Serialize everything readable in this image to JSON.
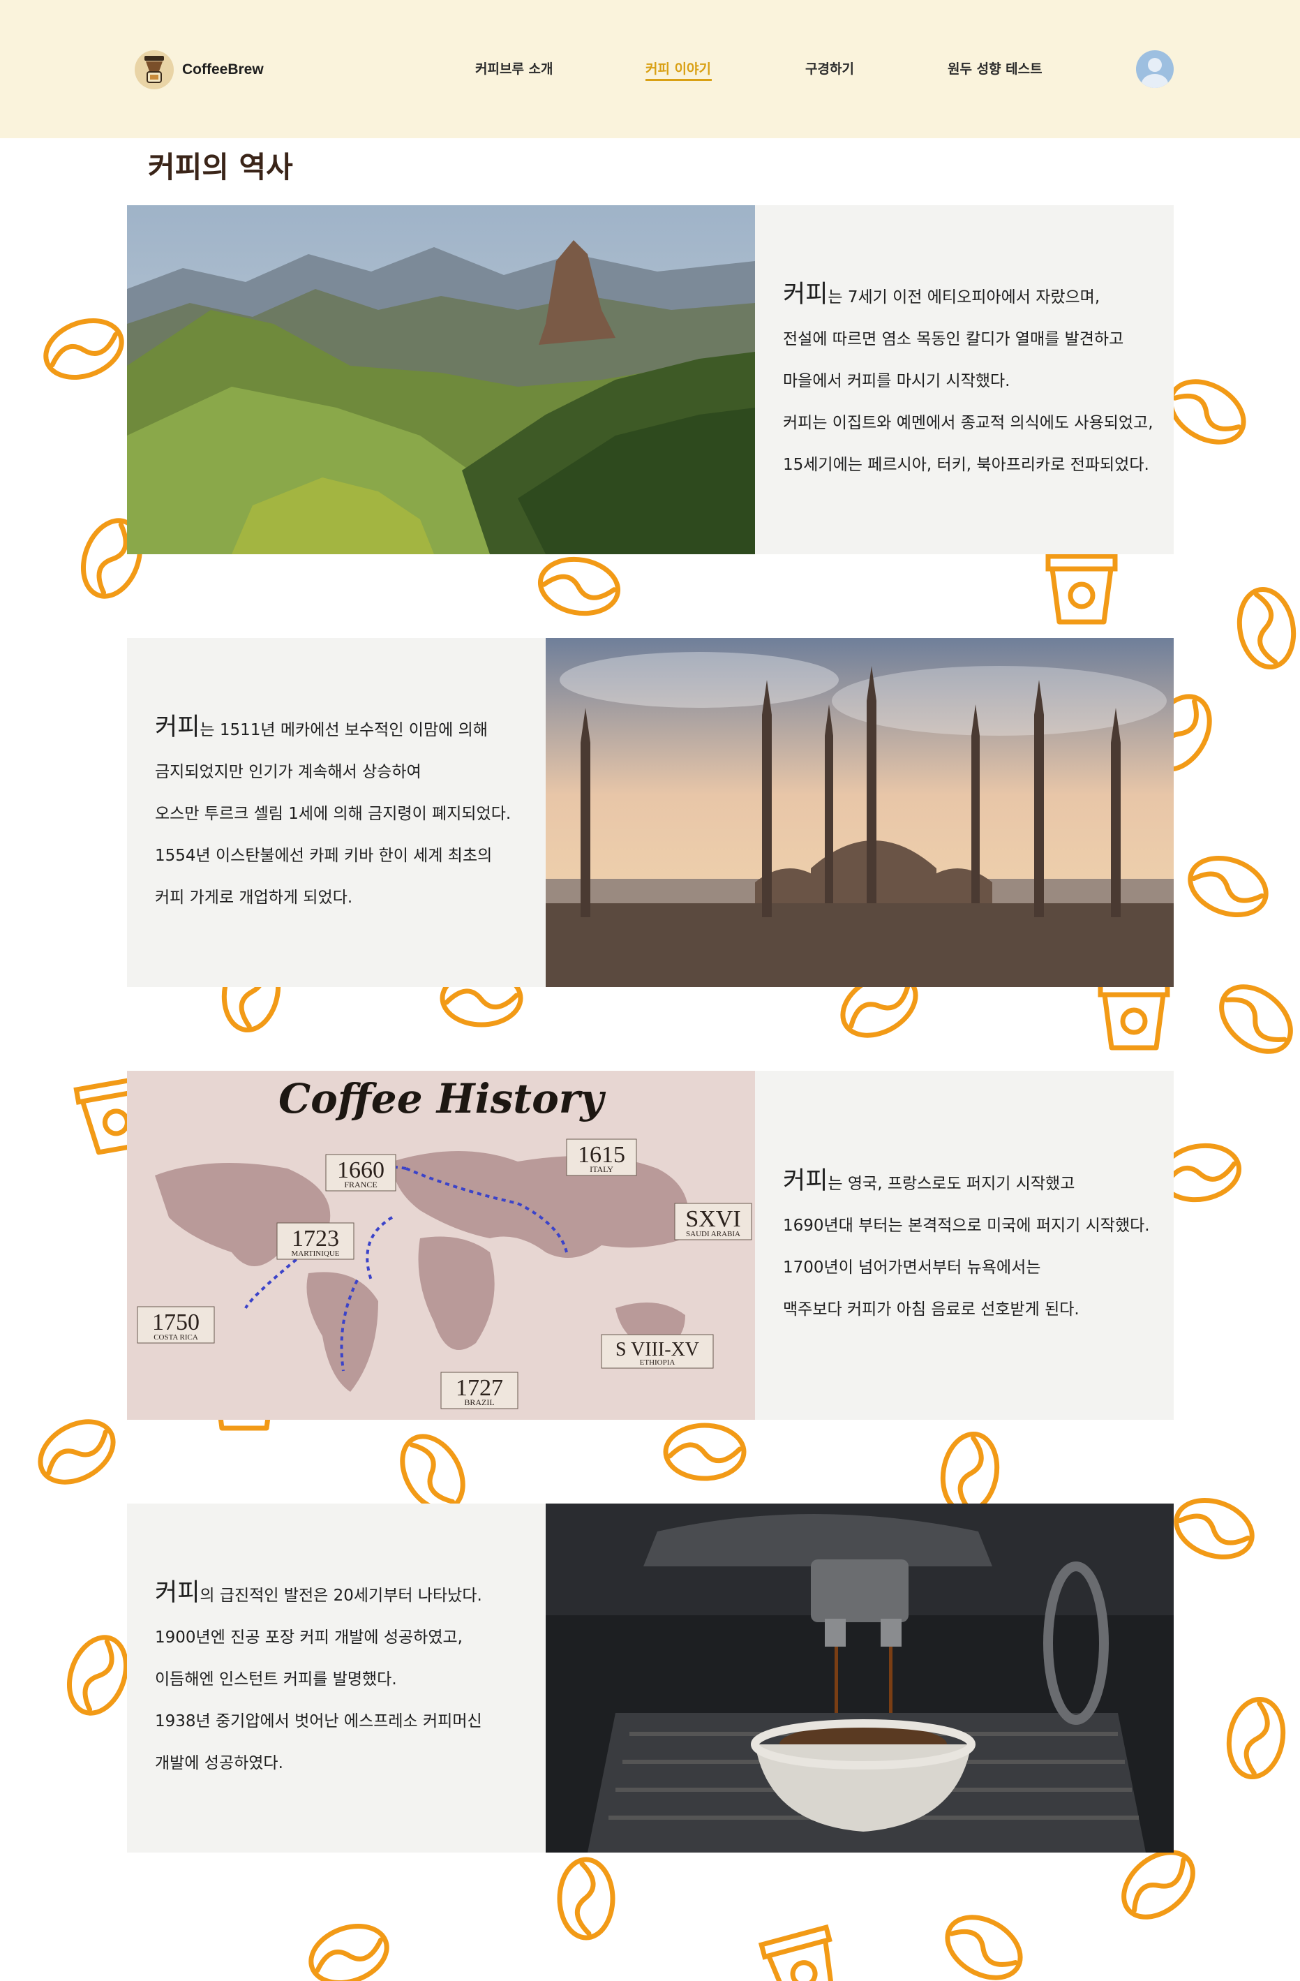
{
  "brand": {
    "name": "CoffeeBrew"
  },
  "nav": {
    "items": [
      {
        "label": "커피브루 소개"
      },
      {
        "label": "커피 이야기"
      },
      {
        "label": "구경하기"
      },
      {
        "label": "원두 성향 테스트"
      }
    ]
  },
  "page": {
    "title": "커피의 역사"
  },
  "colors": {
    "header_bg": "#faf3dc",
    "accent": "#d9a014",
    "doodle": "#f29a16",
    "card_bg": "#f3f3f1"
  },
  "sections": [
    {
      "image": "ethiopian-highlands-photo",
      "lead": "커피",
      "lines": [
        "는 7세기 이전 에티오피아에서 자랐으며,",
        "전설에 따르면 염소 목동인 칼디가 열매를 발견하고",
        "마을에서 커피를 마시기 시작했다.",
        "커피는 이집트와 예멘에서 종교적 의식에도 사용되었고,",
        "15세기에는 페르시아, 터키, 북아프리카로 전파되었다."
      ]
    },
    {
      "image": "istanbul-mosque-photo",
      "lead": "커피",
      "lines": [
        "는 1511년 메카에선 보수적인 이맘에 의해",
        "금지되었지만 인기가 계속해서 상승하여",
        "오스만 투르크 셀림 1세에 의해 금지령이 폐지되었다.",
        "1554년 이스탄불에선 카페 키바 한이 세계 최초의",
        "커피 가게로 개업하게 되었다."
      ]
    },
    {
      "image": "coffee-history-map",
      "map_title": "Coffee History",
      "map_labels": [
        {
          "year": "1660",
          "place": "FRANCE"
        },
        {
          "year": "1615",
          "place": "ITALY"
        },
        {
          "year": "SXVI",
          "place": "SAUDI ARABIA"
        },
        {
          "year": "1723",
          "place": "MARTINIQUE"
        },
        {
          "year": "1750",
          "place": "COSTA RICA"
        },
        {
          "year": "S VIII-XV",
          "place": "ETHIOPIA"
        },
        {
          "year": "1727",
          "place": "BRAZIL"
        }
      ],
      "lead": "커피",
      "lines": [
        "는 영국, 프랑스로도 퍼지기 시작했고",
        "1690년대 부터는 본격적으로 미국에 퍼지기 시작했다.",
        "1700년이 넘어가면서부터 뉴욕에서는",
        "맥주보다 커피가 아침 음료로 선호받게 된다."
      ]
    },
    {
      "image": "espresso-machine-photo",
      "lead": "커피",
      "lines": [
        "의 급진적인 발전은 20세기부터 나타났다.",
        "1900년엔 진공 포장 커피 개발에 성공하였고,",
        "이듬해엔 인스턴트 커피를 발명했다.",
        "1938년 중기압에서 벗어난 에스프레소 커피머신",
        "개발에 성공하였다."
      ]
    }
  ]
}
